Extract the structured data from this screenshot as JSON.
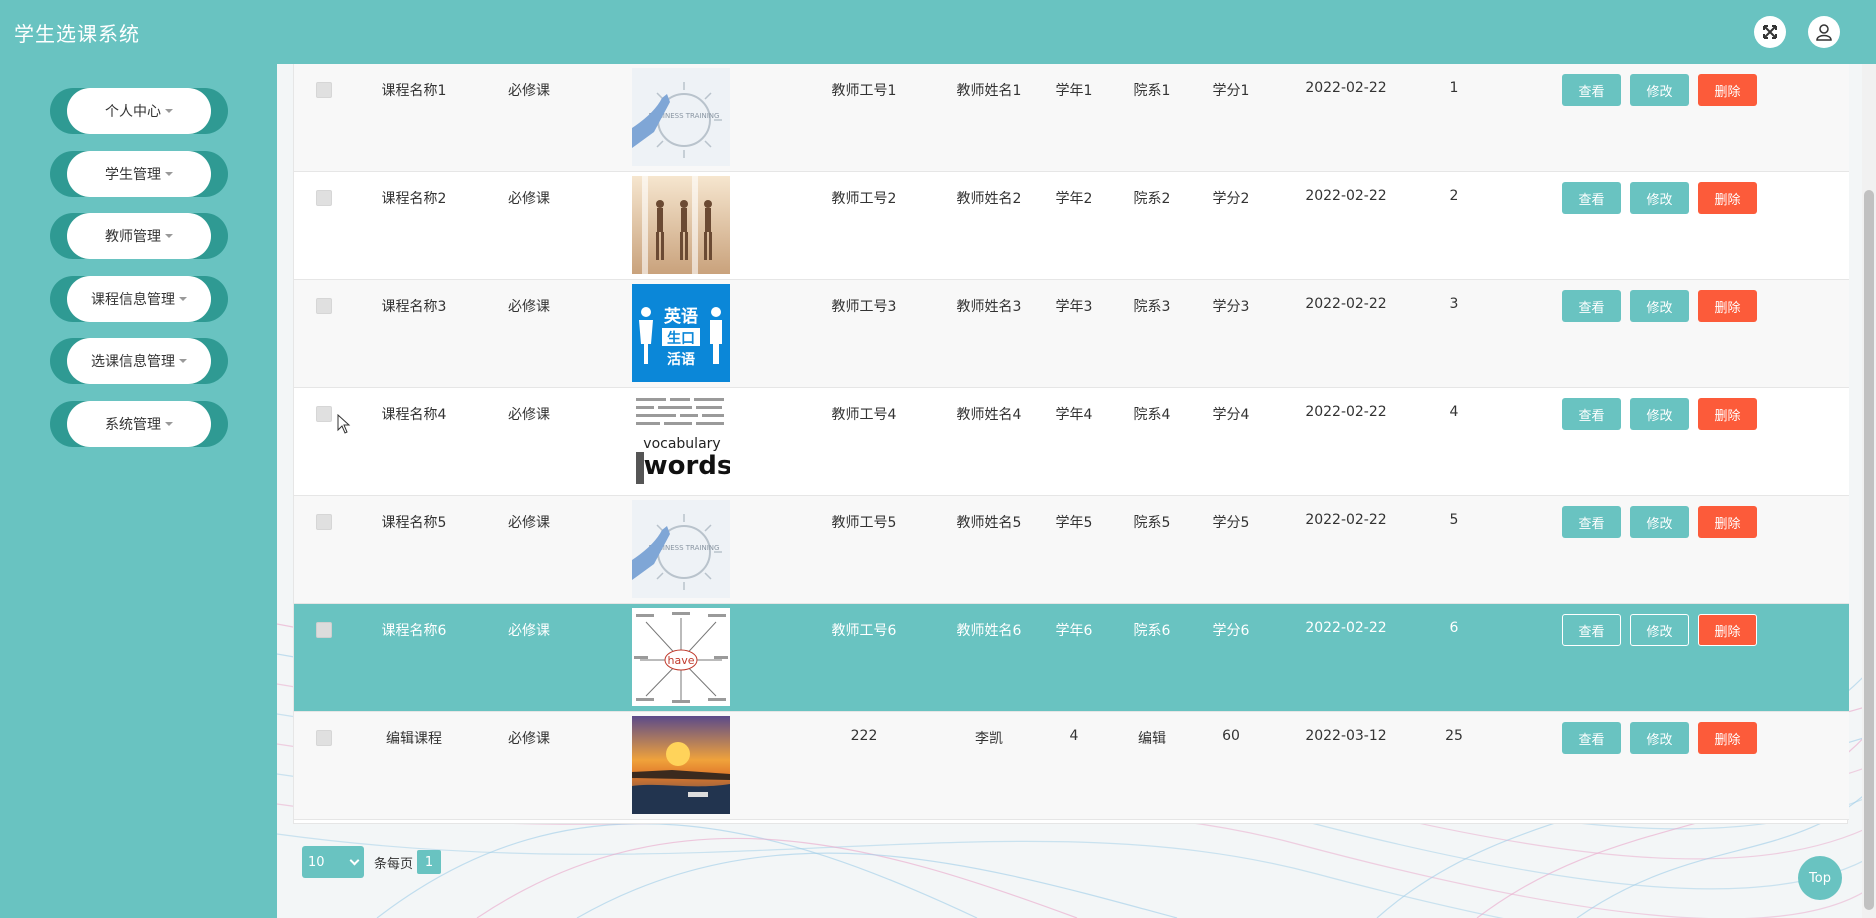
{
  "header": {
    "title": "学生选课系统"
  },
  "sidebar": {
    "items": [
      {
        "label": "个人中心"
      },
      {
        "label": "学生管理"
      },
      {
        "label": "教师管理"
      },
      {
        "label": "课程信息管理"
      },
      {
        "label": "选课信息管理"
      },
      {
        "label": "系统管理"
      }
    ]
  },
  "table": {
    "actions": {
      "view": "查看",
      "edit": "修改",
      "delete": "删除"
    },
    "rows": [
      {
        "name": "课程名称1",
        "type": "必修课",
        "image": "business-training-icon",
        "teacher_id": "教师工号1",
        "teacher_name": "教师姓名1",
        "year": "学年1",
        "dept": "院系1",
        "credit": "学分1",
        "date": "2022-02-22",
        "num": "1"
      },
      {
        "name": "课程名称2",
        "type": "必修课",
        "image": "dancers-icon",
        "teacher_id": "教师工号2",
        "teacher_name": "教师姓名2",
        "year": "学年2",
        "dept": "院系2",
        "credit": "学分2",
        "date": "2022-02-22",
        "num": "2"
      },
      {
        "name": "课程名称3",
        "type": "必修课",
        "image": "english-oral-icon",
        "teacher_id": "教师工号3",
        "teacher_name": "教师姓名3",
        "year": "学年3",
        "dept": "院系3",
        "credit": "学分3",
        "date": "2022-02-22",
        "num": "3"
      },
      {
        "name": "课程名称4",
        "type": "必修课",
        "image": "vocabulary-words-icon",
        "teacher_id": "教师工号4",
        "teacher_name": "教师姓名4",
        "year": "学年4",
        "dept": "院系4",
        "credit": "学分4",
        "date": "2022-02-22",
        "num": "4"
      },
      {
        "name": "课程名称5",
        "type": "必修课",
        "image": "business-training-icon",
        "teacher_id": "教师工号5",
        "teacher_name": "教师姓名5",
        "year": "学年5",
        "dept": "院系5",
        "credit": "学分5",
        "date": "2022-02-22",
        "num": "5"
      },
      {
        "name": "课程名称6",
        "type": "必修课",
        "image": "have-mindmap-icon",
        "teacher_id": "教师工号6",
        "teacher_name": "教师姓名6",
        "year": "学年6",
        "dept": "院系6",
        "credit": "学分6",
        "date": "2022-02-22",
        "num": "6"
      },
      {
        "name": "编辑课程",
        "type": "必修课",
        "image": "sunset-river-icon",
        "teacher_id": "222",
        "teacher_name": "李凯",
        "year": "4",
        "dept": "编辑",
        "credit": "60",
        "date": "2022-03-12",
        "num": "25"
      }
    ]
  },
  "thumb_text": {
    "training": "BUSINESS\nTRAINING",
    "english_1": "英语",
    "english_2": "生口",
    "english_3": "活语",
    "vocabulary": "vocabulary",
    "words": "words",
    "have": "have"
  },
  "pagination": {
    "page_size": "10",
    "per_page_label": "条每页",
    "current_page": "1"
  },
  "top_button": "Top",
  "colors": {
    "primary": "#69c3c1",
    "danger": "#fc5b3a",
    "sidebar_accent": "#2f9a93"
  }
}
